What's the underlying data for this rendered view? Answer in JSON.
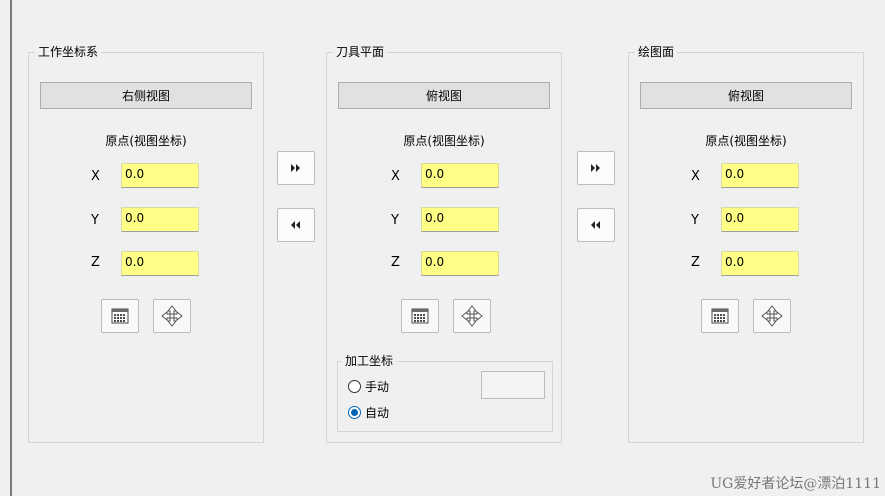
{
  "panels": {
    "work": {
      "title": "工作坐标系",
      "view": "右侧视图",
      "origin_label": "原点(视图坐标)",
      "x": "0.0",
      "y": "0.0",
      "z": "0.0"
    },
    "tool": {
      "title": "刀具平面",
      "view": "俯视图",
      "origin_label": "原点(视图坐标)",
      "x": "0.0",
      "y": "0.0",
      "z": "0.0",
      "machining": {
        "title": "加工坐标",
        "manual_label": "手动",
        "auto_label": "自动",
        "selected": "自动"
      }
    },
    "draw": {
      "title": "绘图面",
      "view": "俯视图",
      "origin_label": "原点(视图坐标)",
      "x": "0.0",
      "y": "0.0",
      "z": "0.0"
    }
  },
  "axis_labels": {
    "x": "X",
    "y": "Y",
    "z": "Z"
  },
  "icons": {
    "calculator": "calculator-icon",
    "move": "move-arrows-icon",
    "forward": "double-right-arrow-icon",
    "back": "double-left-arrow-icon"
  },
  "colors": {
    "field_bg": "#ffff88",
    "radio_accent": "#0063b1"
  },
  "watermark": "UG爱好者论坛@漂泊1111"
}
